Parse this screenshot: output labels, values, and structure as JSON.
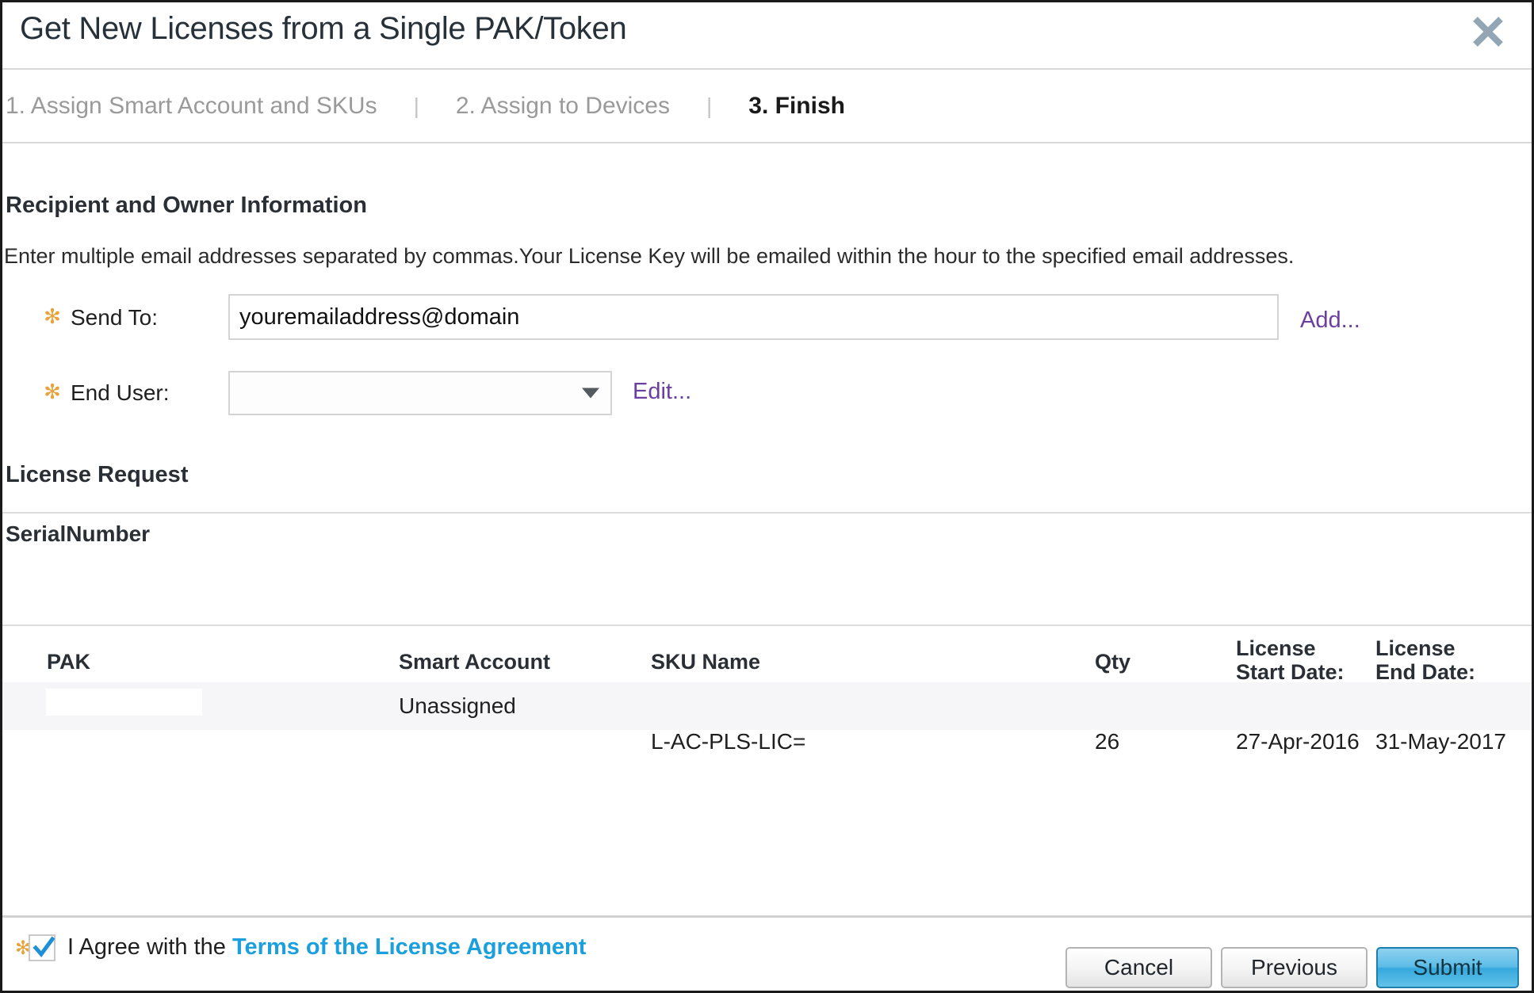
{
  "dialog": {
    "title": "Get New Licenses from a Single PAK/Token",
    "close_icon": "close-icon"
  },
  "steps": {
    "separator": "|",
    "items": [
      {
        "label": "1. Assign Smart Account and SKUs",
        "active": false
      },
      {
        "label": "2. Assign to Devices",
        "active": false
      },
      {
        "label": "3. Finish",
        "active": true
      }
    ]
  },
  "recipient": {
    "heading": "Recipient and Owner Information",
    "helper_text": "Enter multiple email addresses separated by commas.Your License Key will be emailed within the hour to the specified email addresses.",
    "required_marker": "✻",
    "send_to": {
      "label": "Send To:",
      "value": "youremailaddress@domain",
      "placeholder": "",
      "add_link": "Add..."
    },
    "end_user": {
      "label": "End User:",
      "value": "",
      "edit_link": "Edit...",
      "dropdown_icon": "chevron-down-icon"
    }
  },
  "license_request": {
    "heading": "License Request",
    "serial_number_label": "SerialNumber",
    "table": {
      "columns": [
        {
          "key": "pak",
          "label": "PAK"
        },
        {
          "key": "smart_account",
          "label": "Smart Account"
        },
        {
          "key": "sku_name",
          "label": "SKU Name"
        },
        {
          "key": "qty",
          "label": "Qty"
        },
        {
          "key": "license_start_date",
          "label": "License\nStart Date:"
        },
        {
          "key": "license_end_date",
          "label": "License\nEnd Date:"
        }
      ],
      "rows": [
        {
          "pak": "",
          "smart_account": "Unassigned",
          "sku_name": "",
          "qty": "",
          "license_start_date": "",
          "license_end_date": ""
        },
        {
          "pak": "",
          "smart_account": "",
          "sku_name": "L-AC-PLS-LIC=",
          "qty": "26",
          "license_start_date": "27-Apr-2016",
          "license_end_date": "31-May-2017"
        }
      ]
    }
  },
  "footer": {
    "required_marker": "✻",
    "agree_prefix": "I Agree with the ",
    "terms_link": "Terms of the License Agreement",
    "checkbox_checked": true,
    "checkbox_icon": "check-icon",
    "buttons": {
      "cancel": "Cancel",
      "previous": "Previous",
      "submit": "Submit"
    }
  },
  "colors": {
    "accent_link": "#6b3fa0",
    "terms_link": "#1ba0dd",
    "required_star": "#e8a33d",
    "submit_button": "#35a8dd"
  }
}
